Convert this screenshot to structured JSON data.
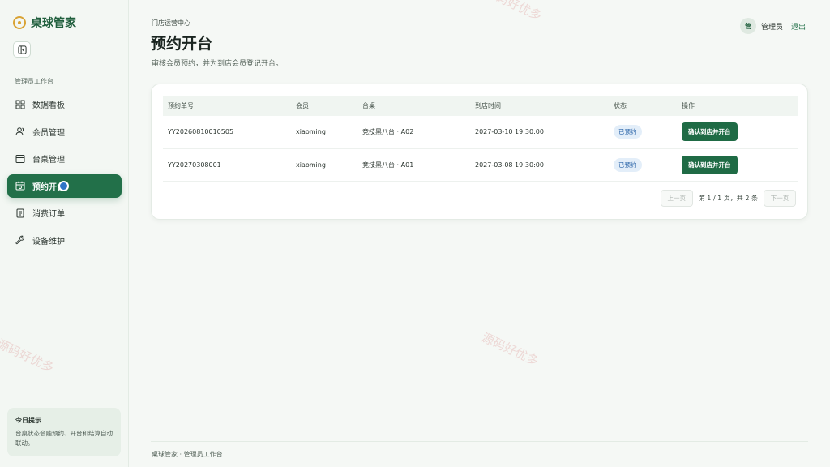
{
  "brand": {
    "name": "桌球管家"
  },
  "sidebar": {
    "section_title": "管理员工作台",
    "items": [
      {
        "label": "数据看板",
        "icon": "dashboard-icon"
      },
      {
        "label": "会员管理",
        "icon": "users-icon"
      },
      {
        "label": "台桌管理",
        "icon": "table-icon"
      },
      {
        "label": "预约开台",
        "icon": "calendar-icon",
        "active": true
      },
      {
        "label": "消费订单",
        "icon": "receipt-icon"
      },
      {
        "label": "设备维护",
        "icon": "wrench-icon"
      }
    ],
    "tip": {
      "title": "今日提示",
      "text": "台桌状态会随预约、开台和结算自动联动。"
    }
  },
  "header": {
    "breadcrumb": "门店运营中心",
    "title": "预约开台",
    "description": "审核会员预约，并为到店会员登记开台。",
    "avatar_text": "管",
    "user_name": "管理员",
    "logout_label": "退出"
  },
  "table": {
    "columns": [
      "预约单号",
      "会员",
      "台桌",
      "到店时间",
      "状态",
      "操作"
    ],
    "rows": [
      {
        "order_no": "YY20260810010505",
        "member": "xiaoming",
        "table": "竞技黑八台 · A02",
        "arrival": "2027-03-10 19:30:00",
        "status": "已预约",
        "action": "确认到店并开台"
      },
      {
        "order_no": "YY20270308001",
        "member": "xiaoming",
        "table": "竞技黑八台 · A01",
        "arrival": "2027-03-08 19:30:00",
        "status": "已预约",
        "action": "确认到店并开台"
      }
    ]
  },
  "pagination": {
    "prev_label": "上一页",
    "info": "第 1 / 1 页，共 2 条",
    "next_label": "下一页"
  },
  "footer": {
    "text": "桌球管家 · 管理员工作台"
  },
  "watermark": {
    "text": "源码好优多"
  },
  "colors": {
    "primary": "#227049",
    "badge_bg": "#e3eef9",
    "badge_text": "#2a64a8",
    "logo": "#d9a334"
  }
}
